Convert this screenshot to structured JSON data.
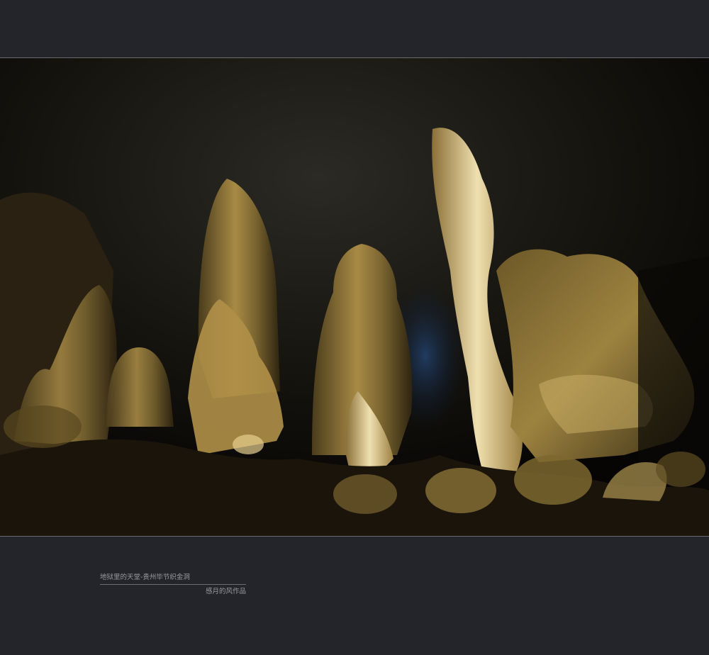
{
  "caption": {
    "title": "地狱里的天堂-贵州毕节织金洞",
    "author": "感月的风作品"
  },
  "photo": {
    "subject": "cave-stalagmites",
    "palette": {
      "background": "#24252b",
      "rock_dark": "#0b0905",
      "rock_lit": "#b89a4a",
      "highlight": "#f2e3b0",
      "cave_blue": "#1d3350"
    }
  }
}
